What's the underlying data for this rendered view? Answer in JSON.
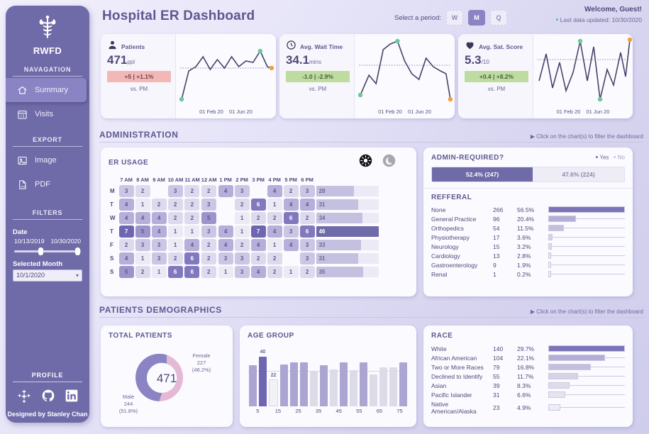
{
  "sidebar": {
    "brand": "RWFD",
    "nav_header": "NAVAGATION",
    "nav_items": [
      {
        "label": "Summary",
        "icon": "home-icon",
        "active": true
      },
      {
        "label": "Visits",
        "icon": "calendar-icon",
        "active": false
      }
    ],
    "export_header": "EXPORT",
    "export_items": [
      {
        "label": "Image",
        "icon": "image-icon"
      },
      {
        "label": "PDF",
        "icon": "pdf-icon"
      }
    ],
    "filters_header": "FILTERS",
    "date_label": "Date",
    "date_start": "10/13/2019",
    "date_end": "10/30/2020",
    "month_label": "Selected Month",
    "month_value": "10/1/2020",
    "profile_header": "PROFILE",
    "social": [
      "tableau-icon",
      "github-icon",
      "linkedin-icon"
    ],
    "credit": "Designed by Stanley Chan"
  },
  "header": {
    "title": "Hospital ER Dashboard",
    "period_label": "Select a period:",
    "periods": [
      {
        "label": "W",
        "selected": false
      },
      {
        "label": "M",
        "selected": true
      },
      {
        "label": "Q",
        "selected": false
      }
    ],
    "welcome": "Welcome, Guest!",
    "last_updated": "Last data updated: 10/30/2020"
  },
  "kpis": [
    {
      "icon": "person-icon",
      "name": "Patients",
      "value": "471",
      "unit": "ppl",
      "delta": "+5 | +1.1%",
      "delta_dir": "down",
      "compare": "vs. PM",
      "axis_start": "01 Feb 20",
      "axis_end": "01 Jun 20",
      "spark": [
        4,
        40,
        50,
        62,
        40,
        58,
        44,
        62,
        46,
        56,
        53,
        66,
        48,
        50
      ],
      "start_marker": "green",
      "peak_marker": "green",
      "end_marker": "orange",
      "ref_line": 50
    },
    {
      "icon": "clock-icon",
      "name": "Avg. Wait Time",
      "value": "34.1",
      "unit": "mins",
      "delta": "-1.0 | -2.9%",
      "delta_dir": "up",
      "compare": "vs. PM",
      "axis_start": "01 Feb 20",
      "axis_end": "01 Jun 20",
      "spark": [
        12,
        30,
        22,
        62,
        72,
        82,
        60,
        40,
        30,
        58,
        46,
        40,
        36,
        6
      ],
      "start_marker": "green",
      "peak_marker": "green",
      "end_marker": "orange",
      "ref_line": 48
    },
    {
      "icon": "heart-icon",
      "name": "Avg. Sat. Score",
      "value": "5.3",
      "unit": "/10",
      "delta": "+0.4 | +8.2%",
      "delta_dir": "up",
      "compare": "vs. PM",
      "axis_start": "01 Feb 20",
      "axis_end": "01 Jun 20",
      "spark": [
        30,
        62,
        24,
        52,
        20,
        44,
        90,
        30,
        80,
        6,
        42,
        26,
        72,
        34,
        96
      ],
      "start_marker": "none",
      "peak_marker": "green",
      "end_marker": "orange",
      "ref_line": 66
    }
  ],
  "sections": {
    "administration": {
      "title": "ADMINISTRATION",
      "hint": "Click on the chart(s) to filter the dashboard"
    },
    "demographics": {
      "title": "PATIENTS DEMOGRAPHICS",
      "hint": "Click on the chart(s) to filter the dashboard"
    }
  },
  "er_usage": {
    "title": "ER USAGE",
    "toggles": [
      {
        "name": "sun-icon",
        "active": true
      },
      {
        "name": "moon-icon",
        "active": false
      }
    ],
    "hours": [
      "7 AM",
      "8 AM",
      "9 AM",
      "10 AM",
      "11 AM",
      "12 AM",
      "1 PM",
      "2 PM",
      "3 PM",
      "4 PM",
      "5 PM",
      "6 PM"
    ],
    "days": [
      "M",
      "T",
      "W",
      "T",
      "F",
      "S",
      "S"
    ],
    "values": [
      [
        3,
        2,
        null,
        3,
        2,
        2,
        4,
        3,
        null,
        4,
        2,
        3
      ],
      [
        4,
        1,
        2,
        2,
        2,
        3,
        null,
        2,
        6,
        1,
        4,
        4
      ],
      [
        4,
        4,
        4,
        2,
        2,
        5,
        null,
        1,
        2,
        2,
        6,
        2
      ],
      [
        7,
        5,
        4,
        1,
        1,
        3,
        4,
        1,
        7,
        4,
        3,
        6
      ],
      [
        2,
        3,
        3,
        1,
        4,
        2,
        4,
        2,
        4,
        1,
        4,
        3
      ],
      [
        4,
        1,
        3,
        2,
        6,
        2,
        3,
        3,
        2,
        2,
        null,
        3
      ],
      [
        5,
        2,
        1,
        6,
        6,
        2,
        1,
        3,
        4,
        2,
        1,
        2
      ]
    ],
    "totals": [
      28,
      31,
      34,
      46,
      33,
      31,
      35
    ],
    "total_max": 46
  },
  "admin_required": {
    "title": "ADMIN-REQUIRED?",
    "legend": [
      "Yes",
      "No"
    ],
    "yes_label": "52.4% (247)",
    "no_label": "47.6% (224)",
    "yes_pct": 52.4,
    "no_pct": 47.6
  },
  "referral": {
    "title": "REFFERAL",
    "rows": [
      {
        "label": "None",
        "count": "266",
        "pct": "56.5%",
        "bar": 100
      },
      {
        "label": "General Practice",
        "count": "96",
        "pct": "20.4%",
        "bar": 36
      },
      {
        "label": "Orthopedics",
        "count": "54",
        "pct": "11.5%",
        "bar": 20
      },
      {
        "label": "Physiotherapy",
        "count": "17",
        "pct": "3.6%",
        "bar": 6
      },
      {
        "label": "Neurology",
        "count": "15",
        "pct": "3.2%",
        "bar": 5
      },
      {
        "label": "Cardiology",
        "count": "13",
        "pct": "2.8%",
        "bar": 4
      },
      {
        "label": "Gastroenterology",
        "count": "9",
        "pct": "1.9%",
        "bar": 3
      },
      {
        "label": "Renal",
        "count": "1",
        "pct": "0.2%",
        "bar": 1
      }
    ]
  },
  "total_patients": {
    "title": "TOTAL PATIENTS",
    "center": "471",
    "male_label": "Male",
    "male_count": "244",
    "male_pct": "(51.8%)",
    "female_label": "Female",
    "female_count": "227",
    "female_pct": "(48.2%)",
    "male_share": 51.8,
    "female_share": 48.2,
    "male_color": "#8a84c4",
    "female_color": "#e3b9d6"
  },
  "age_group": {
    "title": "AGE GROUP",
    "max_label": "40",
    "min_label": "22",
    "ticks": [
      "5",
      "15",
      "25",
      "35",
      "45",
      "55",
      "65",
      "75"
    ],
    "values": [
      33,
      40,
      22,
      34,
      35,
      35,
      28,
      33,
      30,
      35,
      29,
      35,
      26,
      31,
      31,
      35
    ],
    "highlight_max_index": 1,
    "highlight_min_index": 2
  },
  "race": {
    "title": "RACE",
    "rows": [
      {
        "label": "White",
        "count": "140",
        "pct": "29.7%",
        "bar": 100
      },
      {
        "label": "African American",
        "count": "104",
        "pct": "22.1%",
        "bar": 74
      },
      {
        "label": "Two or More Races",
        "count": "79",
        "pct": "16.8%",
        "bar": 56
      },
      {
        "label": "Declined to Identify",
        "count": "55",
        "pct": "11.7%",
        "bar": 39
      },
      {
        "label": "Asian",
        "count": "39",
        "pct": "8.3%",
        "bar": 28
      },
      {
        "label": "Pacific Islander",
        "count": "31",
        "pct": "6.6%",
        "bar": 22
      },
      {
        "label": "Native American/Alaska",
        "count": "23",
        "pct": "4.9%",
        "bar": 16
      }
    ]
  },
  "chart_data": [
    {
      "type": "heatmap",
      "title": "ER USAGE",
      "xlabel": "",
      "ylabel": "",
      "x": [
        "7 AM",
        "8 AM",
        "9 AM",
        "10 AM",
        "11 AM",
        "12 AM",
        "1 PM",
        "2 PM",
        "3 PM",
        "4 PM",
        "5 PM",
        "6 PM"
      ],
      "y": [
        "M",
        "T",
        "W",
        "T",
        "F",
        "S",
        "S"
      ],
      "values": [
        [
          3,
          2,
          null,
          3,
          2,
          2,
          4,
          3,
          null,
          4,
          2,
          3
        ],
        [
          4,
          1,
          2,
          2,
          2,
          3,
          null,
          2,
          6,
          1,
          4,
          4
        ],
        [
          4,
          4,
          4,
          2,
          2,
          5,
          null,
          1,
          2,
          2,
          6,
          2
        ],
        [
          7,
          5,
          4,
          1,
          1,
          3,
          4,
          1,
          7,
          4,
          3,
          6
        ],
        [
          2,
          3,
          3,
          1,
          4,
          2,
          4,
          2,
          4,
          1,
          4,
          3
        ],
        [
          4,
          1,
          3,
          2,
          6,
          2,
          3,
          3,
          2,
          2,
          null,
          3
        ],
        [
          5,
          2,
          1,
          6,
          6,
          2,
          1,
          3,
          4,
          2,
          1,
          2
        ]
      ],
      "row_totals": [
        28,
        31,
        34,
        46,
        33,
        31,
        35
      ]
    },
    {
      "type": "bar",
      "title": "REFFERAL",
      "categories": [
        "None",
        "General Practice",
        "Orthopedics",
        "Physiotherapy",
        "Neurology",
        "Cardiology",
        "Gastroenterology",
        "Renal"
      ],
      "values": [
        266,
        96,
        54,
        17,
        15,
        13,
        9,
        1
      ],
      "percentages": [
        56.5,
        20.4,
        11.5,
        3.6,
        3.2,
        2.8,
        1.9,
        0.2
      ],
      "xlabel": "",
      "ylabel": ""
    },
    {
      "type": "bar",
      "title": "ADMIN-REQUIRED?",
      "categories": [
        "Yes",
        "No"
      ],
      "values": [
        247,
        224
      ],
      "percentages": [
        52.4,
        47.6
      ],
      "xlabel": "",
      "ylabel": ""
    },
    {
      "type": "pie",
      "title": "TOTAL PATIENTS",
      "categories": [
        "Male",
        "Female"
      ],
      "values": [
        244,
        227
      ],
      "percentages": [
        51.8,
        48.2
      ],
      "total": 471
    },
    {
      "type": "bar",
      "title": "AGE GROUP",
      "categories": [
        "0",
        "5",
        "10",
        "15",
        "20",
        "25",
        "30",
        "35",
        "40",
        "45",
        "50",
        "55",
        "60",
        "65",
        "70",
        "75"
      ],
      "values": [
        33,
        40,
        22,
        34,
        35,
        35,
        28,
        33,
        30,
        35,
        29,
        35,
        26,
        31,
        31,
        35
      ],
      "xlabel": "",
      "ylabel": "",
      "ylim": [
        0,
        40
      ]
    },
    {
      "type": "bar",
      "title": "RACE",
      "categories": [
        "White",
        "African American",
        "Two or More Races",
        "Declined to Identify",
        "Asian",
        "Pacific Islander",
        "Native American/Alaska"
      ],
      "values": [
        140,
        104,
        79,
        55,
        39,
        31,
        23
      ],
      "percentages": [
        29.7,
        22.1,
        16.8,
        11.7,
        8.3,
        6.6,
        4.9
      ],
      "xlabel": "",
      "ylabel": ""
    },
    {
      "type": "line",
      "title": "Patients",
      "x": [
        "01 Feb 20",
        "01 Jun 20"
      ],
      "values": [
        4,
        40,
        50,
        62,
        40,
        58,
        44,
        62,
        46,
        56,
        53,
        66,
        48,
        50
      ],
      "kpi_value": 471,
      "kpi_unit": "ppl",
      "delta": "+5 | +1.1%"
    },
    {
      "type": "line",
      "title": "Avg. Wait Time",
      "x": [
        "01 Feb 20",
        "01 Jun 20"
      ],
      "values": [
        12,
        30,
        22,
        62,
        72,
        82,
        60,
        40,
        30,
        58,
        46,
        40,
        36,
        6
      ],
      "kpi_value": 34.1,
      "kpi_unit": "mins",
      "delta": "-1.0 | -2.9%"
    },
    {
      "type": "line",
      "title": "Avg. Sat. Score",
      "x": [
        "01 Feb 20",
        "01 Jun 20"
      ],
      "values": [
        30,
        62,
        24,
        52,
        20,
        44,
        90,
        30,
        80,
        6,
        42,
        26,
        72,
        34,
        96
      ],
      "kpi_value": 5.3,
      "kpi_unit": "/10",
      "delta": "+0.4 | +8.2%"
    }
  ]
}
